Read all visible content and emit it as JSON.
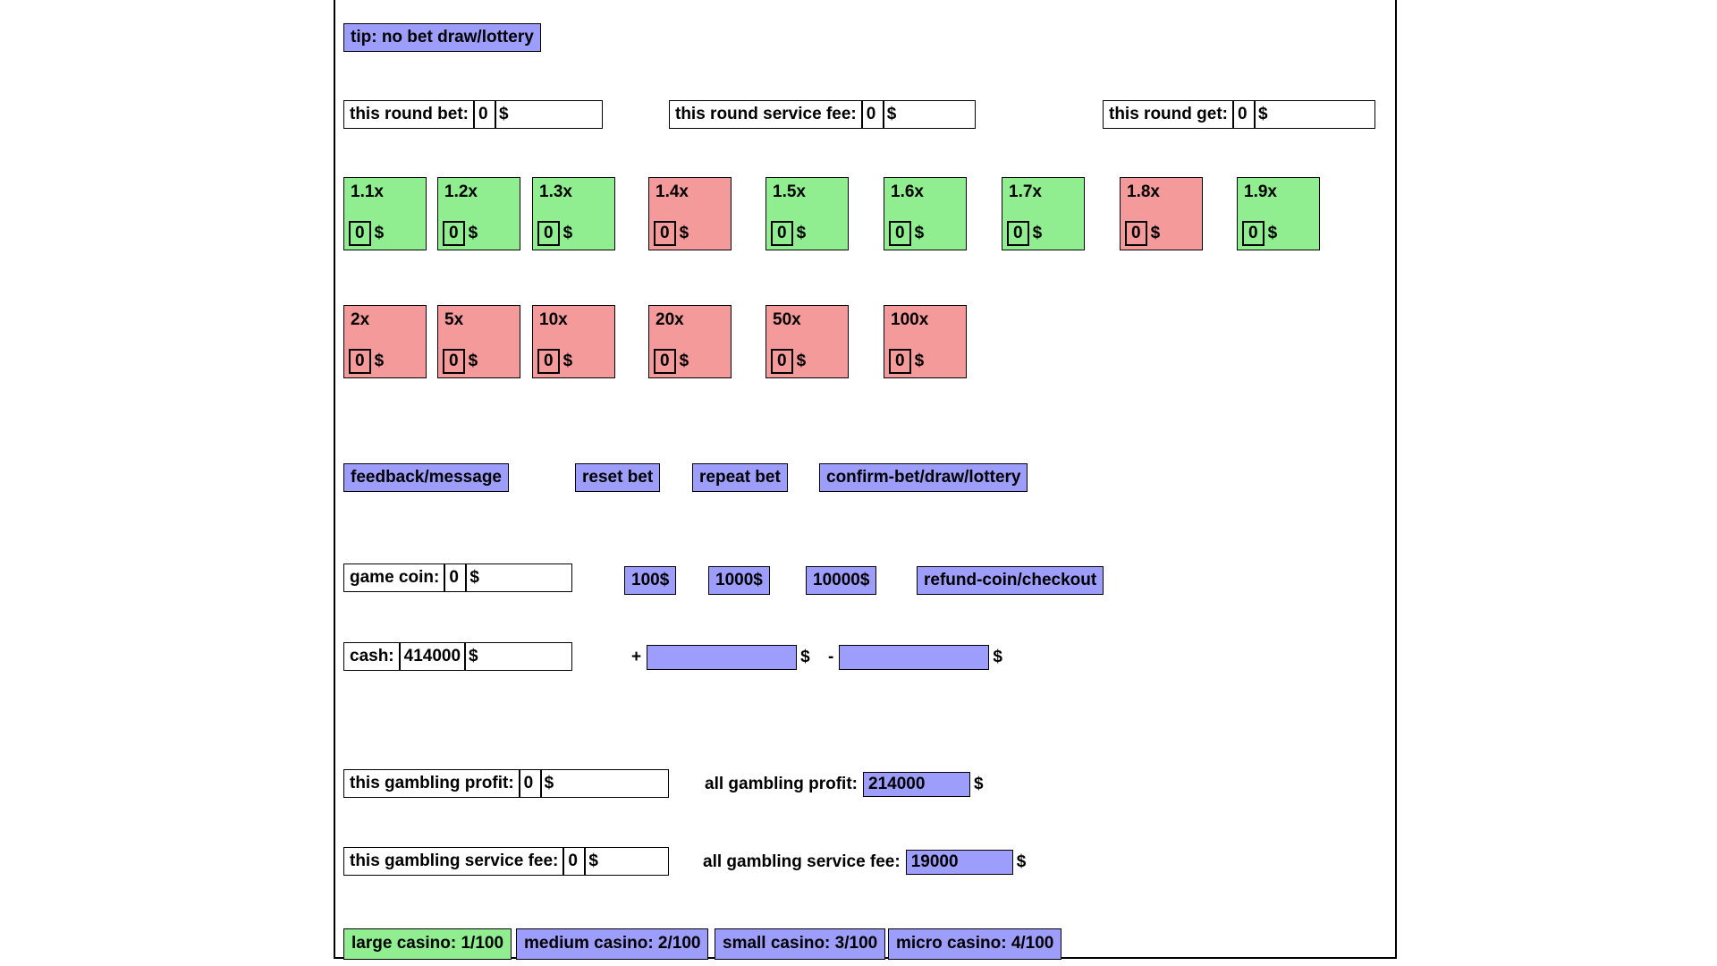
{
  "tip": {
    "label": "tip: no bet draw/lottery"
  },
  "round": {
    "bet": {
      "label": "this round bet:",
      "value": "0",
      "currency": "$"
    },
    "service_fee": {
      "label": "this round service fee:",
      "value": "0",
      "currency": "$"
    },
    "get": {
      "label": "this round get:",
      "value": "0",
      "currency": "$"
    }
  },
  "multipliers_row1": [
    {
      "label": "1.1x",
      "amount": "0",
      "currency": "$",
      "state": "green"
    },
    {
      "label": "1.2x",
      "amount": "0",
      "currency": "$",
      "state": "green"
    },
    {
      "label": "1.3x",
      "amount": "0",
      "currency": "$",
      "state": "green"
    },
    {
      "label": "1.4x",
      "amount": "0",
      "currency": "$",
      "state": "red"
    },
    {
      "label": "1.5x",
      "amount": "0",
      "currency": "$",
      "state": "green"
    },
    {
      "label": "1.6x",
      "amount": "0",
      "currency": "$",
      "state": "green"
    },
    {
      "label": "1.7x",
      "amount": "0",
      "currency": "$",
      "state": "green"
    },
    {
      "label": "1.8x",
      "amount": "0",
      "currency": "$",
      "state": "red"
    },
    {
      "label": "1.9x",
      "amount": "0",
      "currency": "$",
      "state": "green"
    }
  ],
  "multipliers_row2": [
    {
      "label": "2x",
      "amount": "0",
      "currency": "$",
      "state": "red"
    },
    {
      "label": "5x",
      "amount": "0",
      "currency": "$",
      "state": "red"
    },
    {
      "label": "10x",
      "amount": "0",
      "currency": "$",
      "state": "red"
    },
    {
      "label": "20x",
      "amount": "0",
      "currency": "$",
      "state": "red"
    },
    {
      "label": "50x",
      "amount": "0",
      "currency": "$",
      "state": "red"
    },
    {
      "label": "100x",
      "amount": "0",
      "currency": "$",
      "state": "red"
    }
  ],
  "actions": {
    "feedback": "feedback/message",
    "reset_bet": "reset bet",
    "repeat_bet": "repeat bet",
    "confirm_bet": "confirm-bet/draw/lottery"
  },
  "coin": {
    "label": "game coin:",
    "value": "0",
    "currency": "$",
    "buy_100": "100$",
    "buy_1000": "1000$",
    "buy_10000": "10000$",
    "refund": "refund-coin/checkout"
  },
  "cash": {
    "label": "cash:",
    "value": "414000",
    "currency": "$",
    "add_sign": "+",
    "add_value": "",
    "add_currency": "$",
    "sub_sign": "-",
    "sub_value": "",
    "sub_currency": "$"
  },
  "stats": {
    "this_profit": {
      "label": "this gambling profit:",
      "value": "0",
      "currency": "$"
    },
    "all_profit": {
      "label": "all gambling profit:",
      "value": "214000",
      "currency": "$"
    },
    "this_service_fee": {
      "label": "this gambling service fee:",
      "value": "0",
      "currency": "$"
    },
    "all_service_fee": {
      "label": "all gambling service fee:",
      "value": "19000",
      "currency": "$"
    }
  },
  "casinos": [
    {
      "label": "large casino: 1/100",
      "state": "active"
    },
    {
      "label": "medium casino: 2/100",
      "state": "normal"
    },
    {
      "label": "small casino: 3/100",
      "state": "normal"
    },
    {
      "label": "micro casino: 4/100",
      "state": "normal"
    }
  ],
  "colors": {
    "accent_blue": "#9d9dfb",
    "green": "#90ee90",
    "red": "#f59a9a",
    "border": "#000000",
    "background": "#ffffff"
  }
}
